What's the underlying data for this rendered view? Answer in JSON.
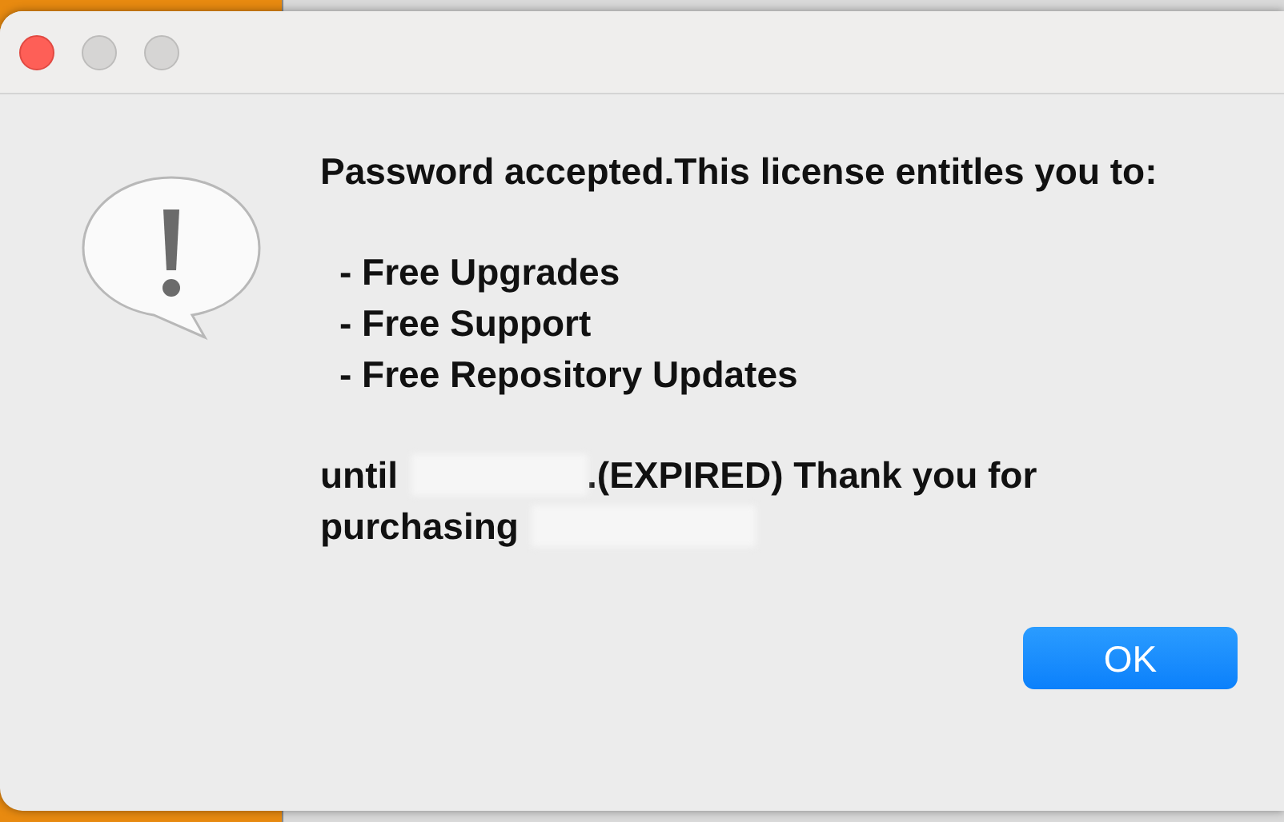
{
  "window": {
    "traffic_lights": [
      {
        "kind": "close"
      },
      {
        "kind": "inactive"
      },
      {
        "kind": "inactive"
      }
    ]
  },
  "message": {
    "headline": "Password accepted.This license entitles you to:",
    "benefits": [
      "- Free Upgrades",
      "- Free Support",
      "- Free Repository Updates"
    ],
    "until_before": "until",
    "until_after": ".(EXPIRED) Thank you for",
    "purchasing": "purchasing"
  },
  "buttons": [
    {
      "label": "OK",
      "default": true
    }
  ]
}
